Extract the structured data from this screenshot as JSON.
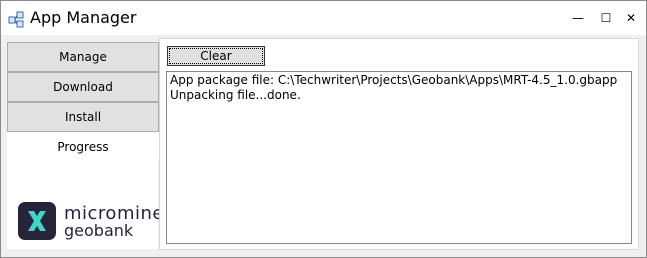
{
  "window": {
    "title": "App Manager",
    "controls": {
      "minimize": "—",
      "maximize": "☐",
      "close": "✕"
    }
  },
  "sidebar": {
    "items": [
      {
        "label": "Manage"
      },
      {
        "label": "Download"
      },
      {
        "label": "Install"
      },
      {
        "label": "Progress",
        "selected": true
      }
    ]
  },
  "logo": {
    "line1": "micromine",
    "line2": "geobank",
    "icon": "micromine-x-logo",
    "colors": {
      "mark_bg": "#27233a",
      "mark_fg": "#3dd6c8"
    }
  },
  "progress": {
    "clear_label": "Clear",
    "log_lines": [
      "App package file: C:\\Techwriter\\Projects\\Geobank\\Apps\\MRT-4.5_1.0.gbapp",
      "Unpacking file...done."
    ]
  }
}
